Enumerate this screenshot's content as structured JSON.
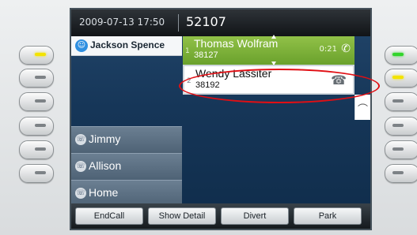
{
  "header": {
    "datetime": "2009-07-13 17:50",
    "line_number": "52107"
  },
  "identity": {
    "name": "Jackson Spence",
    "icon": "phone-user-icon"
  },
  "speed_dials": [
    {
      "label": "Jimmy",
      "icon": "speed-dial-icon"
    },
    {
      "label": "Allison",
      "icon": "speed-dial-icon"
    },
    {
      "label": "Home",
      "icon": "speed-dial-icon"
    }
  ],
  "calls": [
    {
      "index": "1",
      "name": "Thomas Wolfram",
      "number": "38127",
      "timer": "0:21",
      "state": "connected",
      "icon": "connected-call-icon"
    },
    {
      "index": "2",
      "name": "Wendy Lassiter",
      "number": "38192",
      "state": "ringing",
      "icon": "ringing-call-icon"
    }
  ],
  "feature_icons": {
    "hangup": "hangup-icon"
  },
  "softkeys": [
    "EndCall",
    "Show Detail",
    "Divert",
    "Park"
  ],
  "colors": {
    "active_call": "#7ab33a",
    "highlight": "#e10f14",
    "lamp_yellow": "#f3e300",
    "lamp_green": "#33d52c"
  }
}
